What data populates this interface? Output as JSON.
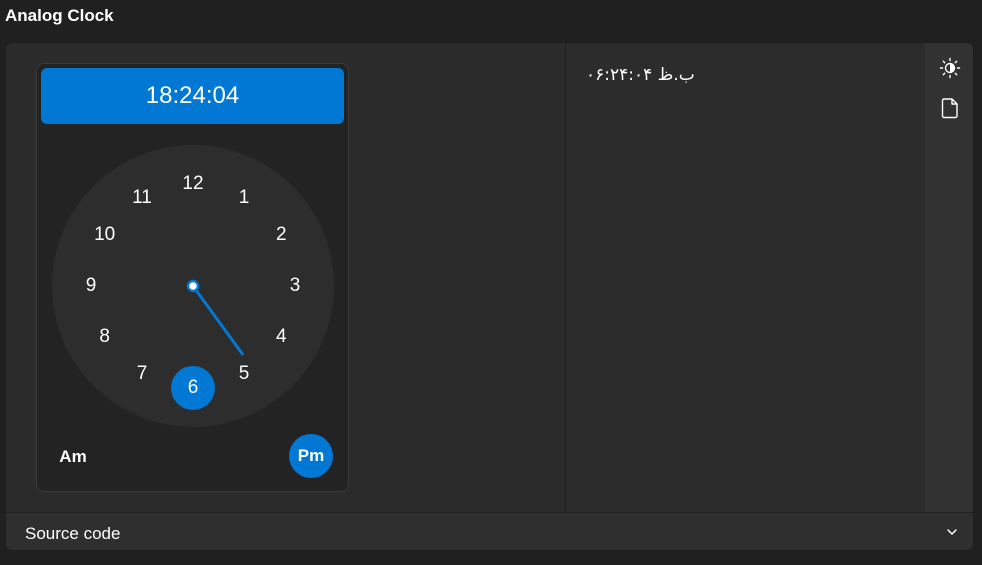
{
  "page": {
    "title": "Analog Clock"
  },
  "clock": {
    "time_display": "18:24:04",
    "hours": [
      {
        "label": "12"
      },
      {
        "label": "1"
      },
      {
        "label": "2"
      },
      {
        "label": "3"
      },
      {
        "label": "4"
      },
      {
        "label": "5"
      },
      {
        "label": "6"
      },
      {
        "label": "7"
      },
      {
        "label": "8"
      },
      {
        "label": "9"
      },
      {
        "label": "10"
      },
      {
        "label": "11"
      }
    ],
    "selected_hour": "6",
    "minute_value": 24,
    "am_label": "Am",
    "pm_label": "Pm",
    "period_selected": "Pm"
  },
  "output": {
    "text": "ب.ظ ۰۶:۲۴:۰۴"
  },
  "toolbar": {
    "icons": [
      "theme-toggle-icon",
      "document-icon"
    ]
  },
  "footer": {
    "label": "Source code"
  },
  "colors": {
    "accent": "#0078d4",
    "background": "#202020",
    "card": "#2b2b2b"
  }
}
